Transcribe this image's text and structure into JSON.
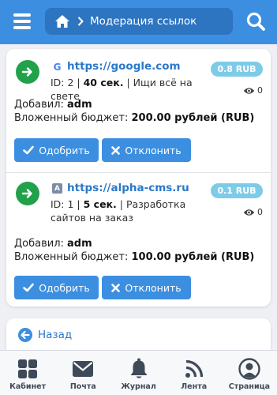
{
  "header": {
    "breadcrumb_title": "Модерация ссылок"
  },
  "links": [
    {
      "url": "https://google.com",
      "favicon": "G",
      "price": "0.8 RUB",
      "id_text": "ID: 2 | ",
      "time": "40 сек.",
      "desc_text": " | Ищи всё на свете",
      "views": "0",
      "added_label": "Добавил: ",
      "added_by": "adm",
      "budget_label": "Вложенный бюджет: ",
      "budget_value": "200.00 рублей (RUB)",
      "approve_label": "Одобрить",
      "reject_label": "Отклонить"
    },
    {
      "url": "https://alpha-cms.ru",
      "favicon": "A",
      "price": "0.1 RUB",
      "id_text": "ID: 1 | ",
      "time": "5 сек.",
      "desc_text": " | Разработка сайтов на заказ",
      "views": "0",
      "added_label": "Добавил: ",
      "added_by": "adm",
      "budget_label": "Вложенный бюджет: ",
      "budget_value": "100.00 рублей (RUB)",
      "approve_label": "Одобрить",
      "reject_label": "Отклонить"
    }
  ],
  "back_label": "Назад",
  "bottom_nav": [
    {
      "label": "Кабинет",
      "icon": "grid-icon"
    },
    {
      "label": "Почта",
      "icon": "mail-icon"
    },
    {
      "label": "Журнал",
      "icon": "bell-icon"
    },
    {
      "label": "Лента",
      "icon": "rss-icon"
    },
    {
      "label": "Страница",
      "icon": "user-icon"
    }
  ],
  "colors": {
    "header": "#3c8fe0",
    "breadcrumb": "#2d74c1",
    "link": "#2b78c9",
    "price_badge": "#7ecbe8",
    "go_circle": "#22a14a",
    "button": "#3c8fe0"
  }
}
